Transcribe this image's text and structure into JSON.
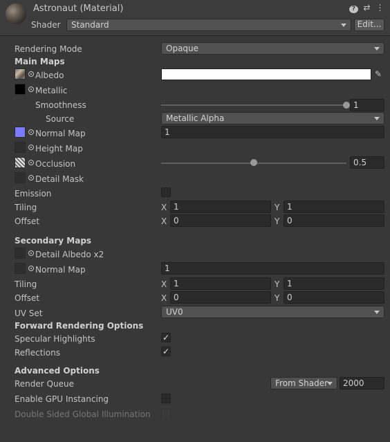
{
  "header": {
    "title": "Astronaut (Material)",
    "shader_label": "Shader",
    "shader_value": "Standard",
    "edit_label": "Edit...",
    "icons": [
      "help-icon",
      "settings-icon",
      "more-icon"
    ]
  },
  "props": {
    "rendering_mode_label": "Rendering Mode",
    "rendering_mode_value": "Opaque",
    "main_maps_label": "Main Maps",
    "albedo_label": "Albedo",
    "albedo_color": "#ffffff",
    "metallic_label": "Metallic",
    "smoothness_label": "Smoothness",
    "smoothness_value": "1",
    "smoothness_level": 1.0,
    "source_label": "Source",
    "source_value": "Metallic Alpha",
    "normal_map_label": "Normal Map",
    "normal_map_value": "1",
    "height_map_label": "Height Map",
    "occlusion_label": "Occlusion",
    "occlusion_value": "0.5",
    "occlusion_level": 0.5,
    "detail_mask_label": "Detail Mask",
    "emission_label": "Emission",
    "tiling_label": "Tiling",
    "tiling_x": "1",
    "tiling_y": "1",
    "offset_label": "Offset",
    "offset_x": "0",
    "offset_y": "0",
    "x_label": "X",
    "y_label": "Y"
  },
  "secondary": {
    "section_label": "Secondary Maps",
    "detail_albedo_label": "Detail Albedo x2",
    "normal_map_label": "Normal Map",
    "normal_map_value": "1",
    "tiling_label": "Tiling",
    "tiling_x": "1",
    "tiling_y": "1",
    "offset_label": "Offset",
    "offset_x": "0",
    "offset_y": "0",
    "uv_set_label": "UV Set",
    "uv_set_value": "UV0"
  },
  "forward": {
    "section_label": "Forward Rendering Options",
    "specular_label": "Specular Highlights",
    "specular_checked": true,
    "reflections_label": "Reflections",
    "reflections_checked": true
  },
  "advanced": {
    "section_label": "Advanced Options",
    "render_queue_label": "Render Queue",
    "render_queue_source": "From Shader",
    "render_queue_value": "2000",
    "gpu_instancing_label": "Enable GPU Instancing",
    "double_sided_label": "Double Sided Global Illumination"
  },
  "colors": {
    "normal_map_swatch": "#7b7bff",
    "background": "#383838"
  }
}
